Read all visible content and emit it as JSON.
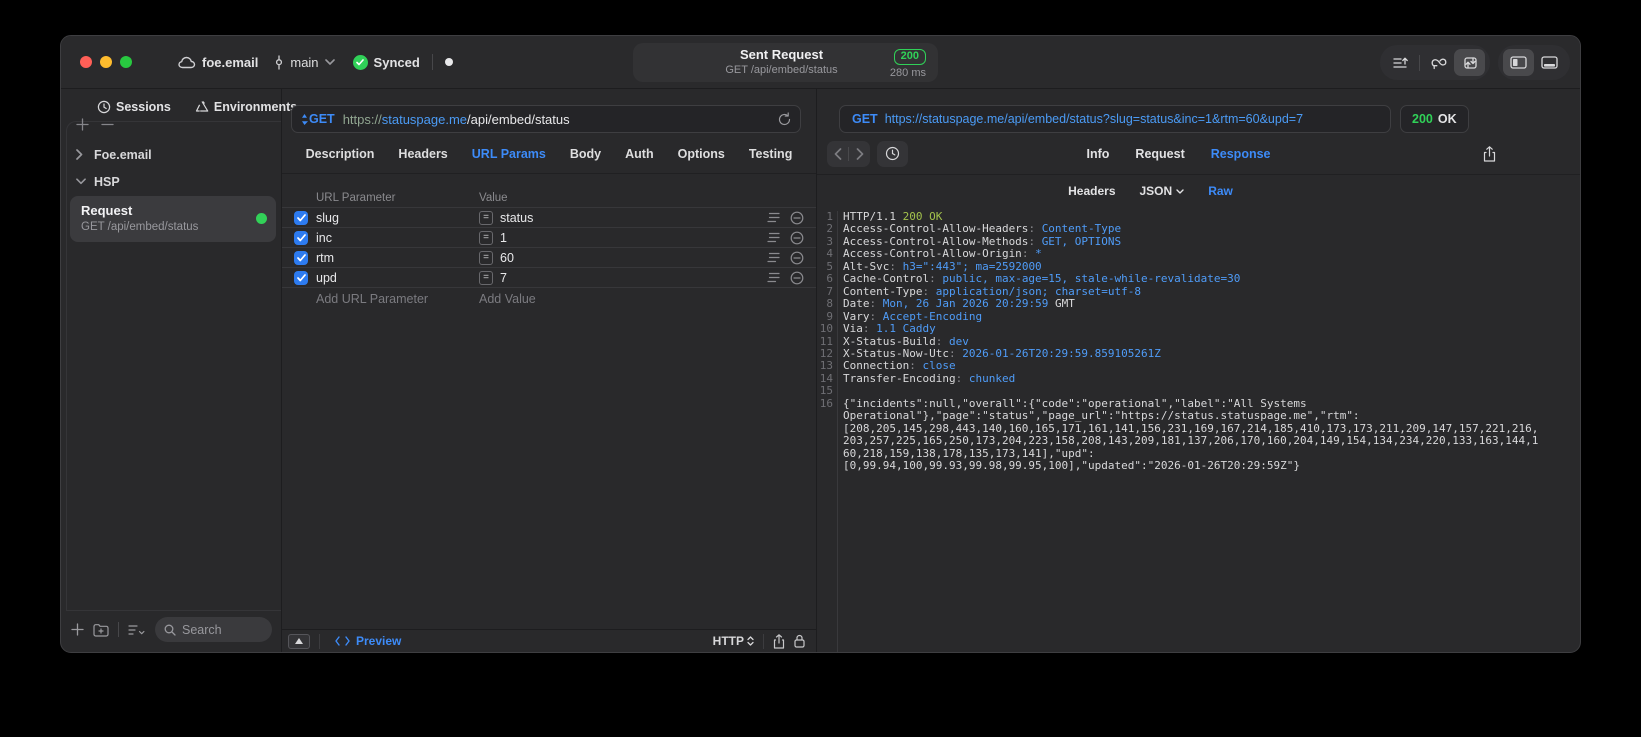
{
  "titlebar": {
    "project": "foe.email",
    "branch": "main",
    "sync_label": "Synced",
    "request_summary": {
      "title": "Sent Request",
      "subtitle": "GET /api/embed/status",
      "status_code": "200",
      "duration": "280 ms"
    }
  },
  "sidebar": {
    "tabs": [
      {
        "label": "Sessions"
      },
      {
        "label": "Environments"
      }
    ],
    "tree": [
      {
        "label": "Foe.email",
        "expanded": false
      },
      {
        "label": "HSP",
        "expanded": true
      }
    ],
    "request_item": {
      "title": "Request",
      "subtitle": "GET /api/embed/status"
    },
    "search_placeholder": "Search"
  },
  "request_editor": {
    "method": "GET",
    "url_scheme": "https://",
    "url_host": "statuspage.me",
    "url_path": "/api/embed/status",
    "tabs": [
      "Description",
      "Headers",
      "URL Params",
      "Body",
      "Auth",
      "Options",
      "Testing"
    ],
    "active_tab": "URL Params",
    "param_table": {
      "columns": [
        "URL Parameter",
        "Value"
      ],
      "rows": [
        {
          "name": "slug",
          "value": "status",
          "enabled": true
        },
        {
          "name": "inc",
          "value": "1",
          "enabled": true
        },
        {
          "name": "rtm",
          "value": "60",
          "enabled": true
        },
        {
          "name": "upd",
          "value": "7",
          "enabled": true
        }
      ],
      "add_name_placeholder": "Add URL Parameter",
      "add_value_placeholder": "Add Value"
    },
    "footer": {
      "preview_label": "Preview",
      "protocol": "HTTP"
    }
  },
  "response_viewer": {
    "method": "GET",
    "url": "https://statuspage.me/api/embed/status?slug=status&inc=1&rtm=60&upd=7",
    "status_code": "200",
    "status_text": "OK",
    "tabs": [
      "Info",
      "Request",
      "Response"
    ],
    "active_tab": "Response",
    "subtabs": [
      "Headers",
      "JSON",
      "Raw"
    ],
    "active_subtab": "Raw",
    "code_rows": [
      {
        "n": "1",
        "segs": [
          {
            "t": "HTTP/1.1 ",
            "c": "w"
          },
          {
            "t": "200 OK",
            "c": "g"
          }
        ]
      },
      {
        "n": "2",
        "segs": [
          {
            "t": "Access-Control-Allow-Headers",
            "c": "w"
          },
          {
            "t": ": ",
            "c": "d"
          },
          {
            "t": "Content-Type",
            "c": "b"
          }
        ]
      },
      {
        "n": "3",
        "segs": [
          {
            "t": "Access-Control-Allow-Methods",
            "c": "w"
          },
          {
            "t": ": ",
            "c": "d"
          },
          {
            "t": "GET, OPTIONS",
            "c": "b"
          }
        ]
      },
      {
        "n": "4",
        "segs": [
          {
            "t": "Access-Control-Allow-Origin",
            "c": "w"
          },
          {
            "t": ": ",
            "c": "d"
          },
          {
            "t": "*",
            "c": "b"
          }
        ]
      },
      {
        "n": "5",
        "segs": [
          {
            "t": "Alt-Svc",
            "c": "w"
          },
          {
            "t": ": ",
            "c": "d"
          },
          {
            "t": "h3=\":443\"; ma=2592000",
            "c": "b"
          }
        ]
      },
      {
        "n": "6",
        "segs": [
          {
            "t": "Cache-Control",
            "c": "w"
          },
          {
            "t": ": ",
            "c": "d"
          },
          {
            "t": "public, max-age=15, stale-while-revalidate=30",
            "c": "b"
          }
        ]
      },
      {
        "n": "7",
        "segs": [
          {
            "t": "Content-Type",
            "c": "w"
          },
          {
            "t": ": ",
            "c": "d"
          },
          {
            "t": "application/json; charset=utf-8",
            "c": "b"
          }
        ]
      },
      {
        "n": "8",
        "segs": [
          {
            "t": "Date",
            "c": "w"
          },
          {
            "t": ": ",
            "c": "d"
          },
          {
            "t": "Mon, 26 Jan 2026 20:29:59",
            "c": "b"
          },
          {
            "t": " GMT",
            "c": "w"
          }
        ]
      },
      {
        "n": "9",
        "segs": [
          {
            "t": "Vary",
            "c": "w"
          },
          {
            "t": ": ",
            "c": "d"
          },
          {
            "t": "Accept-Encoding",
            "c": "b"
          }
        ]
      },
      {
        "n": "10",
        "segs": [
          {
            "t": "Via",
            "c": "w"
          },
          {
            "t": ": ",
            "c": "d"
          },
          {
            "t": "1.1 Caddy",
            "c": "b"
          }
        ]
      },
      {
        "n": "11",
        "segs": [
          {
            "t": "X-Status-Build",
            "c": "w"
          },
          {
            "t": ": ",
            "c": "d"
          },
          {
            "t": "dev",
            "c": "b"
          }
        ]
      },
      {
        "n": "12",
        "segs": [
          {
            "t": "X-Status-Now-Utc",
            "c": "w"
          },
          {
            "t": ": ",
            "c": "d"
          },
          {
            "t": "2026-01-26T20:29:59.859105261Z",
            "c": "b"
          }
        ]
      },
      {
        "n": "13",
        "segs": [
          {
            "t": "Connection",
            "c": "w"
          },
          {
            "t": ": ",
            "c": "d"
          },
          {
            "t": "close",
            "c": "b"
          }
        ]
      },
      {
        "n": "14",
        "segs": [
          {
            "t": "Transfer-Encoding",
            "c": "w"
          },
          {
            "t": ": ",
            "c": "d"
          },
          {
            "t": "chunked",
            "c": "b"
          }
        ]
      },
      {
        "n": "15",
        "segs": []
      },
      {
        "n": "16",
        "segs": [
          {
            "t": "{\"incidents\":null,\"overall\":{\"code\":\"operational\",\"label\":\"All Systems",
            "c": "w"
          }
        ]
      },
      {
        "n": "",
        "segs": [
          {
            "t": "Operational\"},\"page\":\"status\",\"page_url\":\"https://status.statuspage.me\",\"rtm\":",
            "c": "w"
          }
        ]
      },
      {
        "n": "",
        "segs": [
          {
            "t": "[208,205,145,298,443,140,160,165,171,161,141,156,231,169,167,214,185,410,173,173,211,209,147,157,221,216,",
            "c": "w"
          }
        ]
      },
      {
        "n": "",
        "segs": [
          {
            "t": "203,257,225,165,250,173,204,223,158,208,143,209,181,137,206,170,160,204,149,154,134,234,220,133,163,144,1",
            "c": "w"
          }
        ]
      },
      {
        "n": "",
        "segs": [
          {
            "t": "60,218,159,138,178,135,173,141],\"upd\":",
            "c": "w"
          }
        ]
      },
      {
        "n": "",
        "segs": [
          {
            "t": "[0,99.94,100,99.93,99.98,99.95,100],\"updated\":\"2026-01-26T20:29:59Z\"}",
            "c": "w"
          }
        ]
      }
    ]
  },
  "colors": {
    "accent_blue": "#3d8bf8",
    "status_green": "#30d158",
    "code_green": "#a3c24c",
    "code_blue": "#4f9cf8"
  }
}
